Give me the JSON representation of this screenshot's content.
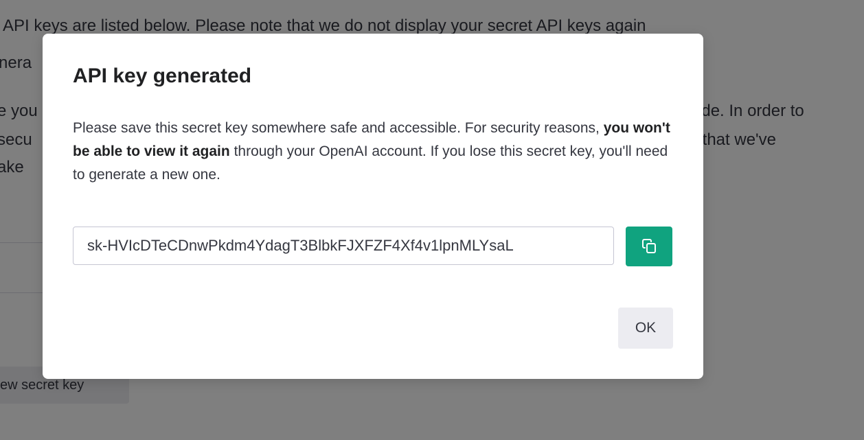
{
  "background": {
    "text_lines": [
      "API keys are listed below. Please note that we do not display your secret API keys again",
      "nera",
      "e you",
      "secu",
      "ake"
    ],
    "right_text_lines": [
      "ode. In order to",
      "y that we've"
    ],
    "button_label": "ew secret key"
  },
  "modal": {
    "title": "API key generated",
    "body_before": "Please save this secret key somewhere safe and accessible. For security reasons, ",
    "body_bold": "you won't be able to view it again",
    "body_after": " through your OpenAI account. If you lose this secret key, you'll need to generate a new one.",
    "secret_key": "sk-HVIcDTeCDnwPkdm4YdagT3BlbkFJXFZF4Xf4v1lpnMLYsaL",
    "copy_icon": "copy-icon",
    "ok_label": "OK"
  },
  "colors": {
    "accent": "#10a37f",
    "overlay": "rgba(0,0,0,0.5)",
    "button_secondary": "#ececf1"
  }
}
